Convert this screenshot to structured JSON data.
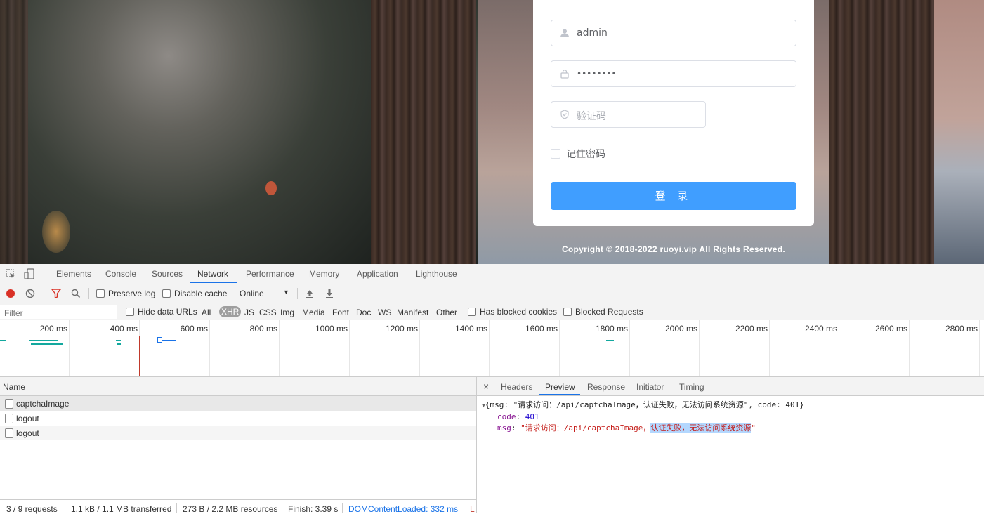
{
  "login": {
    "username_value": "admin",
    "password_value": "••••••••",
    "captcha_placeholder": "验证码",
    "remember_label": "记住密码",
    "login_button": "登 录",
    "copyright": "Copyright © 2018-2022 ruoyi.vip All Rights Reserved.",
    "accent_color": "#409eff"
  },
  "devtools": {
    "tabs": [
      "Elements",
      "Console",
      "Sources",
      "Network",
      "Performance",
      "Memory",
      "Application",
      "Lighthouse"
    ],
    "active_tab": "Network",
    "toolbar": {
      "preserve_log": "Preserve log",
      "disable_cache": "Disable cache",
      "throttle": "Online"
    },
    "filter": {
      "placeholder": "Filter",
      "hide_data_urls": "Hide data URLs",
      "types": [
        "All",
        "XHR",
        "JS",
        "CSS",
        "Img",
        "Media",
        "Font",
        "Doc",
        "WS",
        "Manifest",
        "Other"
      ],
      "selected_type": "XHR",
      "has_blocked_cookies": "Has blocked cookies",
      "blocked_requests": "Blocked Requests"
    },
    "timeline_ticks": [
      "200 ms",
      "400 ms",
      "600 ms",
      "800 ms",
      "1000 ms",
      "1200 ms",
      "1400 ms",
      "1600 ms",
      "1800 ms",
      "2000 ms",
      "2200 ms",
      "2400 ms",
      "2600 ms",
      "2800 ms"
    ],
    "list": {
      "header": "Name",
      "rows": [
        "captchaImage",
        "logout",
        "logout"
      ]
    },
    "detail": {
      "close": "×",
      "tabs": [
        "Headers",
        "Preview",
        "Response",
        "Initiator",
        "Timing"
      ],
      "active_tab": "Preview",
      "summary": "{msg: \"请求访问：/api/captchaImage，认证失败，无法访问系统资源\", code: 401}",
      "code_key": "code",
      "code_value": "401",
      "msg_key": "msg",
      "msg_prefix": "\"请求访问：/api/captchaImage，",
      "msg_highlight": "认证失败，无法访问系统资源",
      "msg_suffix": "\""
    },
    "status": {
      "requests": "3 / 9 requests",
      "transferred": "1.1 kB / 1.1 MB transferred",
      "resources": "273 B / 2.2 MB resources",
      "finish": "Finish: 3.39 s",
      "dom": "DOMContentLoaded: 332 ms",
      "load": "L"
    }
  }
}
